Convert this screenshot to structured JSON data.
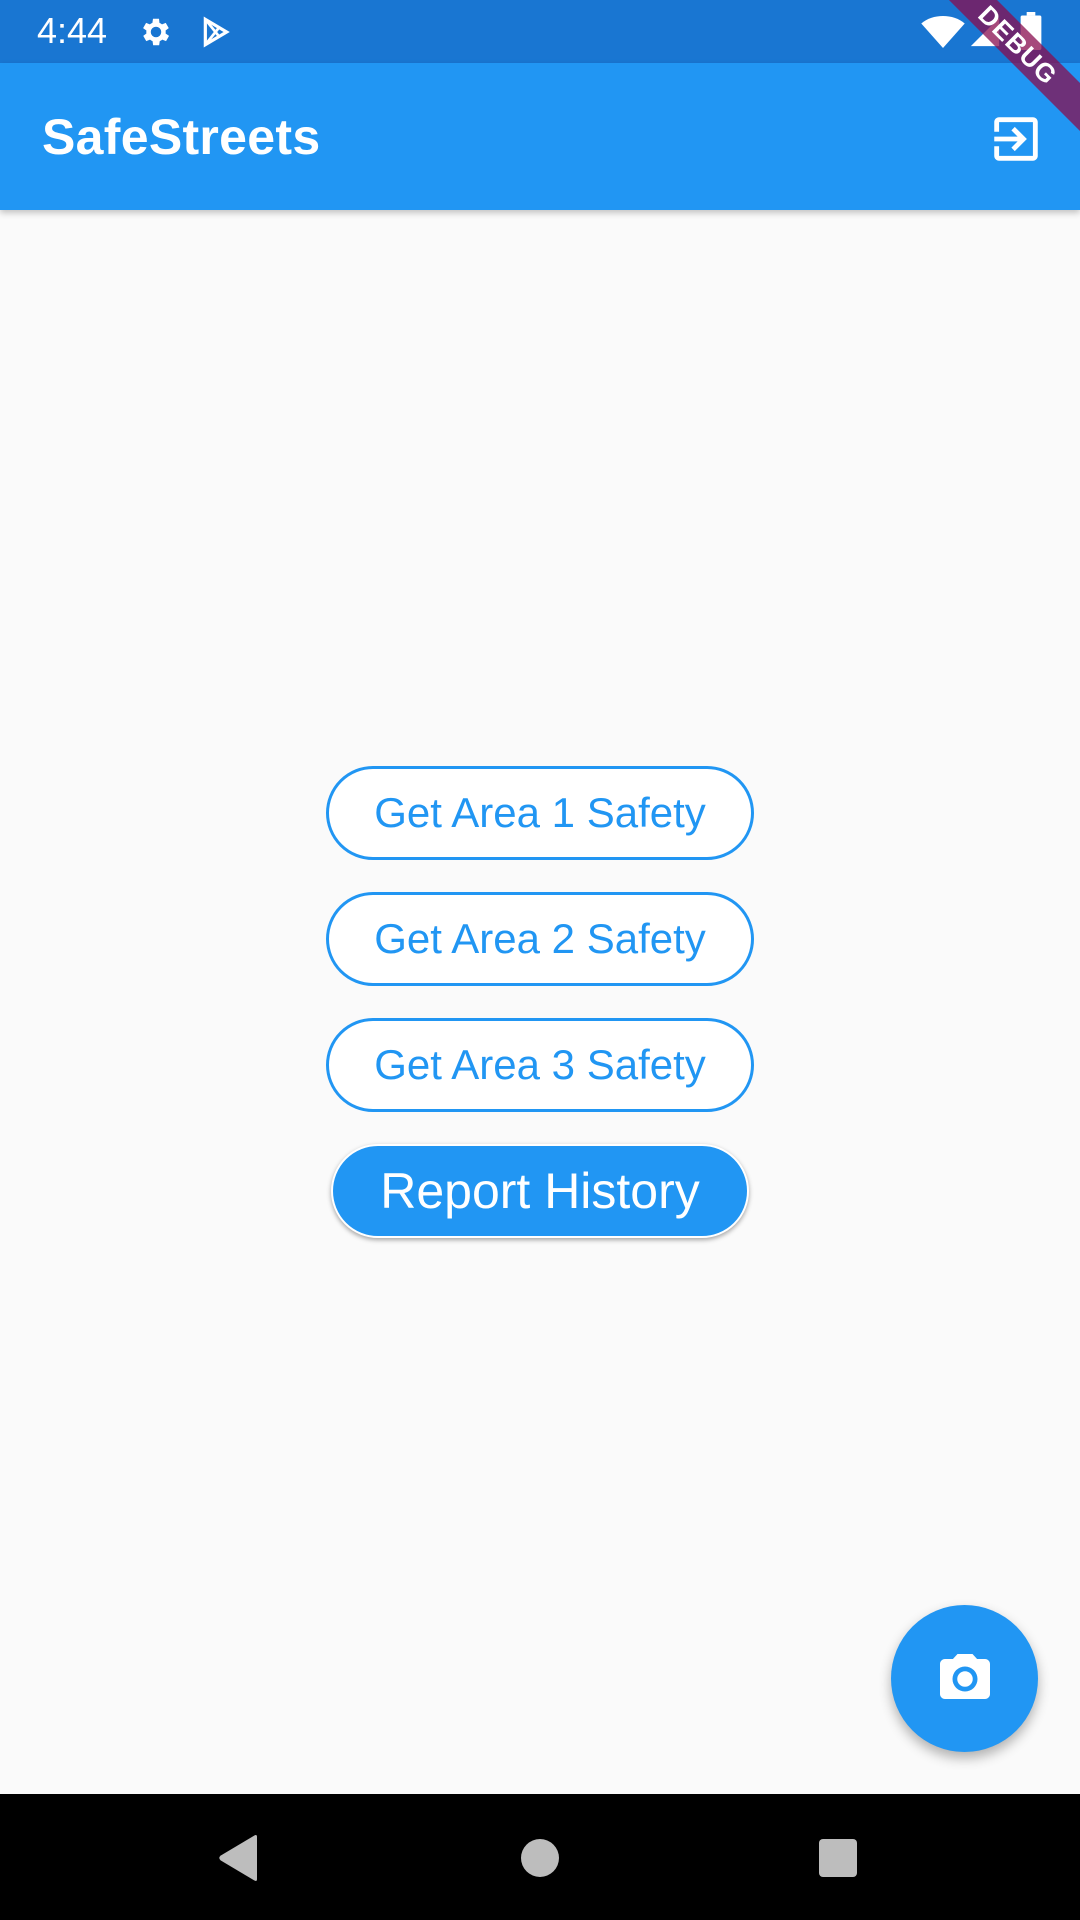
{
  "status_bar": {
    "time": "4:44",
    "icons": [
      "gear-icon",
      "play-store-icon",
      "wifi-icon",
      "signal-icon",
      "battery-icon"
    ]
  },
  "debug_banner": {
    "label": "DEBUG"
  },
  "app_bar": {
    "title": "SafeStreets",
    "action_icon": "logout-icon"
  },
  "buttons": {
    "area1": "Get Area 1 Safety",
    "area2": "Get Area 2 Safety",
    "area3": "Get Area 3 Safety",
    "history": "Report History"
  },
  "fab": {
    "icon": "camera-icon"
  },
  "nav_bar": {
    "icons": [
      "back-icon",
      "home-icon",
      "recent-apps-icon"
    ]
  },
  "colors": {
    "status_bar": "#1976d2",
    "primary": "#2196f3",
    "background": "#fafafa",
    "debug_banner": "#880e4f"
  }
}
